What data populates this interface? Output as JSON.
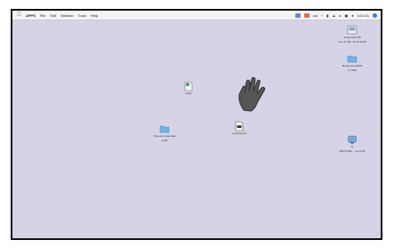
{
  "menubar": {
    "app_name": "APPS",
    "menus": [
      "File",
      "Edit",
      "Window",
      "Tools",
      "Help"
    ],
    "status_text": "cal",
    "clock": "4:31:51"
  },
  "desktop": {
    "icons": [
      {
        "name": "screenshot",
        "label": "Screenshot 09",
        "sublabel": "11.1.17 05...at 10.33.05"
      },
      {
        "name": "folder-top",
        "label": "Brownstone2025",
        "sublabel": "or 1tl05"
      },
      {
        "name": "notes",
        "label": "notes",
        "sublabel": ""
      },
      {
        "name": "pdf",
        "label": "preview.pdf",
        "sublabel": ""
      },
      {
        "name": "folder-left",
        "label": "Personal materials",
        "sublabel": "2 kB"
      },
      {
        "name": "app",
        "label": "D",
        "sublabel": "APPSTHE ... at 10.33"
      }
    ]
  },
  "colors": {
    "desktop": "#d6d3e6",
    "menubar": "#f4f4f6",
    "folder": "#6fb4e8"
  }
}
